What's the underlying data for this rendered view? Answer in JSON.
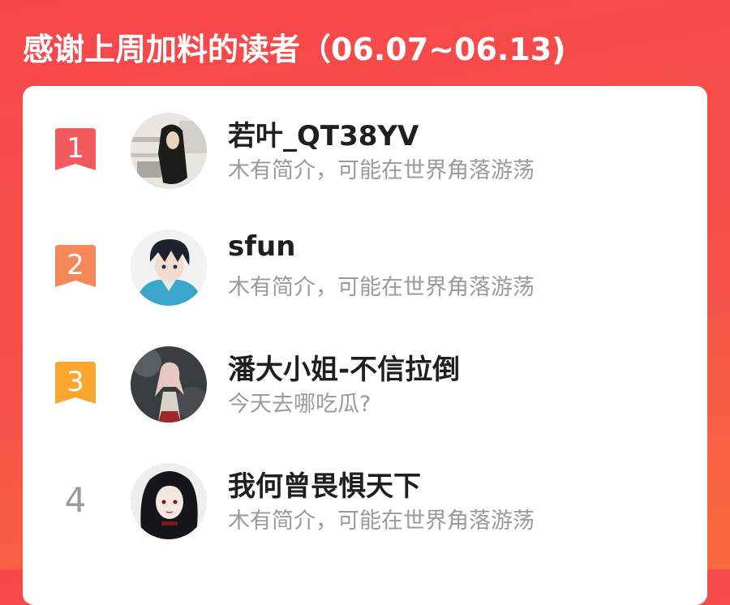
{
  "header": {
    "title": "感谢上周加料的读者（06.07~06.13)"
  },
  "colors": {
    "background_top": "#f7474b",
    "background_bottom": "#f96a3e",
    "rank1_badge": "#f25a5e",
    "rank2_badge": "#f68759",
    "rank3_badge": "#f9a62e",
    "rank_plain": "#9b9b9b",
    "name_text": "#1f1f1f",
    "bio_text": "#9a9a9a"
  },
  "readers": [
    {
      "rank": "1",
      "name": "若叶_QT38YV",
      "bio": "木有简介，可能在世界角落游荡",
      "avatar_icon": "girl-classroom-avatar"
    },
    {
      "rank": "2",
      "name": "sfun",
      "bio": "木有简介，可能在世界角落游荡",
      "avatar_icon": "anime-boy-hoodie-avatar"
    },
    {
      "rank": "3",
      "name": "潘大小姐-不信拉倒",
      "bio": "今天去哪吃瓜?",
      "avatar_icon": "anime-girl-dress-avatar"
    },
    {
      "rank": "4",
      "name": "我何曾畏惧天下",
      "bio": "木有简介，可能在世界角落游荡",
      "avatar_icon": "anime-dark-hair-avatar"
    }
  ]
}
